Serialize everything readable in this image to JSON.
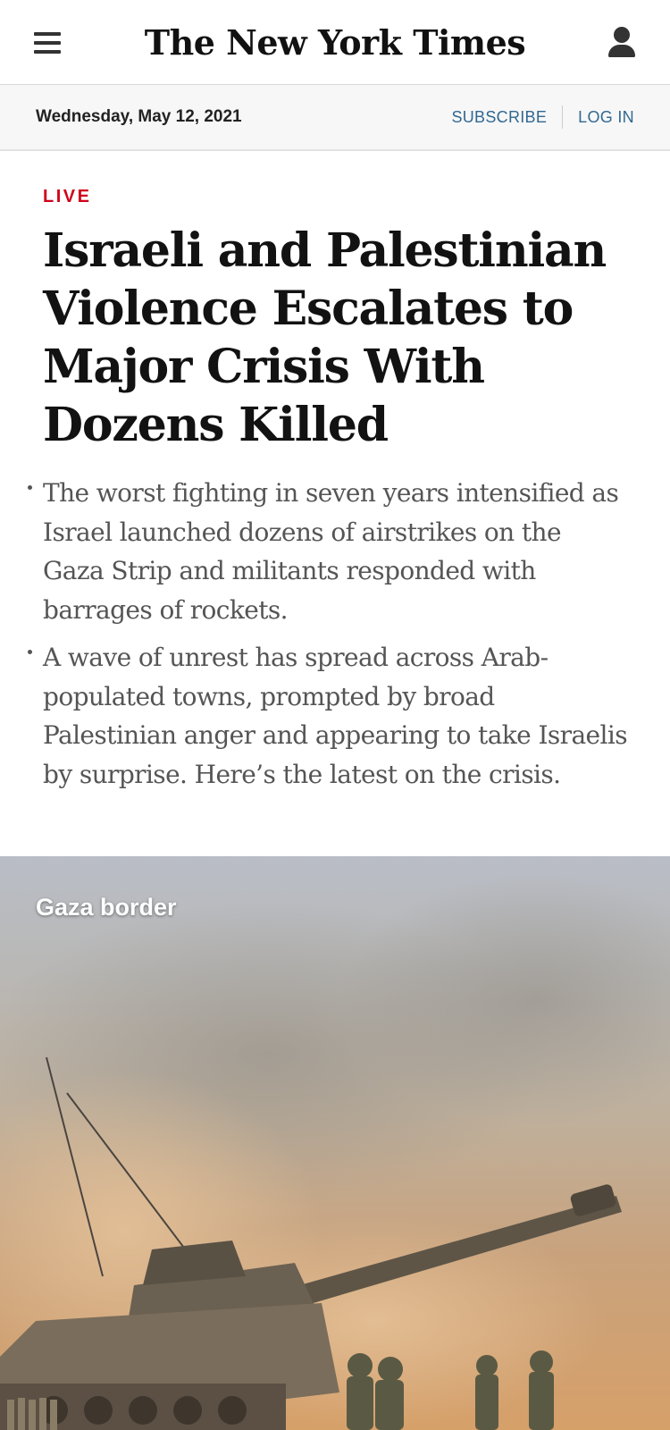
{
  "masthead": {
    "logo": "The New York Times",
    "menu_icon": "hamburger-menu-icon",
    "account_icon": "user-account-icon"
  },
  "datebar": {
    "date": "Wednesday, May 12, 2021",
    "subscribe": "SUBSCRIBE",
    "login": "LOG IN"
  },
  "story": {
    "kicker": "LIVE",
    "headline": "Israeli and Palestinian Violence Escalates to Major Crisis With Dozens Killed",
    "summary": [
      "The worst fighting in seven years intensified as Israel launched dozens of airstrikes on the Gaza Strip and militants responded with barrages of rockets.",
      "A wave of unrest has spread across Arab-populated towns, prompted by broad Palestinian anger and appearing to take Israelis by surprise. Here’s the latest on the crisis."
    ]
  },
  "photo": {
    "label": "Gaza border"
  },
  "colors": {
    "live_red": "#d0021b",
    "link_blue": "#326891",
    "datebar_bg": "#f7f7f7"
  }
}
